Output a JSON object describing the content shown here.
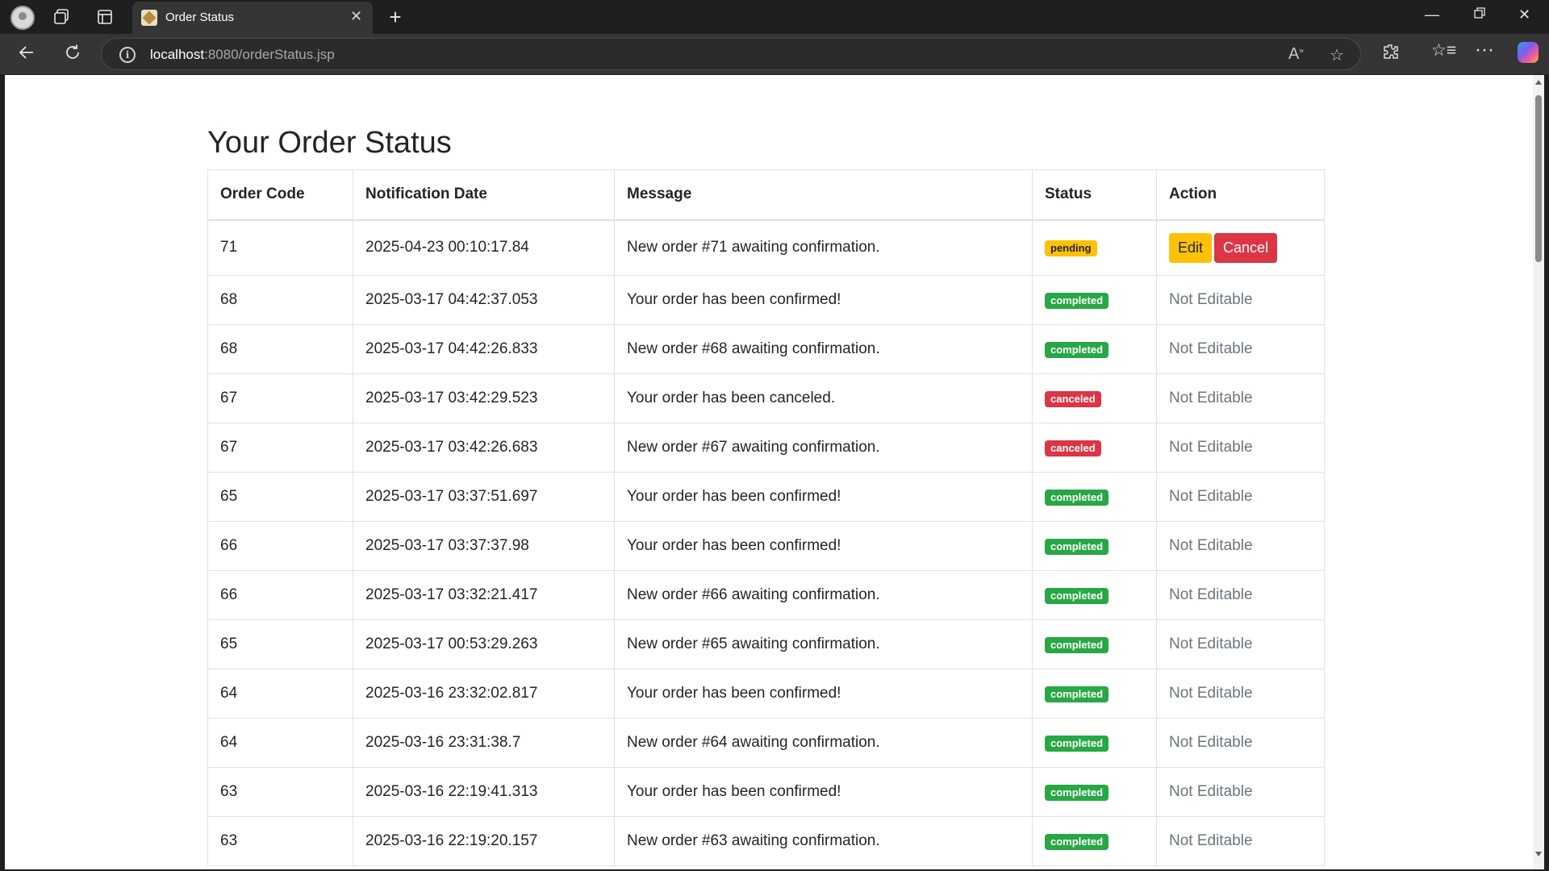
{
  "browser": {
    "tab_title": "Order Status",
    "url_host": "localhost",
    "url_path": ":8080/orderStatus.jsp"
  },
  "page": {
    "title": "Your Order Status"
  },
  "table": {
    "headers": [
      "Order Code",
      "Notification Date",
      "Message",
      "Status",
      "Action"
    ],
    "rows": [
      {
        "code": "71",
        "date": "2025-04-23 00:10:17.84",
        "message": "New order #71 awaiting confirmation.",
        "status": "pending",
        "action": "",
        "edit_label": "Edit",
        "cancel_label": "Cancel"
      },
      {
        "code": "68",
        "date": "2025-03-17 04:42:37.053",
        "message": "Your order has been confirmed!",
        "status": "completed",
        "action": "Not Editable"
      },
      {
        "code": "68",
        "date": "2025-03-17 04:42:26.833",
        "message": "New order #68 awaiting confirmation.",
        "status": "completed",
        "action": "Not Editable"
      },
      {
        "code": "67",
        "date": "2025-03-17 03:42:29.523",
        "message": "Your order has been canceled.",
        "status": "canceled",
        "action": "Not Editable"
      },
      {
        "code": "67",
        "date": "2025-03-17 03:42:26.683",
        "message": "New order #67 awaiting confirmation.",
        "status": "canceled",
        "action": "Not Editable"
      },
      {
        "code": "65",
        "date": "2025-03-17 03:37:51.697",
        "message": "Your order has been confirmed!",
        "status": "completed",
        "action": "Not Editable"
      },
      {
        "code": "66",
        "date": "2025-03-17 03:37:37.98",
        "message": "Your order has been confirmed!",
        "status": "completed",
        "action": "Not Editable"
      },
      {
        "code": "66",
        "date": "2025-03-17 03:32:21.417",
        "message": "New order #66 awaiting confirmation.",
        "status": "completed",
        "action": "Not Editable"
      },
      {
        "code": "65",
        "date": "2025-03-17 00:53:29.263",
        "message": "New order #65 awaiting confirmation.",
        "status": "completed",
        "action": "Not Editable"
      },
      {
        "code": "64",
        "date": "2025-03-16 23:32:02.817",
        "message": "Your order has been confirmed!",
        "status": "completed",
        "action": "Not Editable"
      },
      {
        "code": "64",
        "date": "2025-03-16 23:31:38.7",
        "message": "New order #64 awaiting confirmation.",
        "status": "completed",
        "action": "Not Editable"
      },
      {
        "code": "63",
        "date": "2025-03-16 22:19:41.313",
        "message": "Your order has been confirmed!",
        "status": "completed",
        "action": "Not Editable"
      },
      {
        "code": "63",
        "date": "2025-03-16 22:19:20.157",
        "message": "New order #63 awaiting confirmation.",
        "status": "completed",
        "action": "Not Editable"
      }
    ]
  },
  "colors": {
    "pending": "#ffc107",
    "completed": "#28a745",
    "canceled": "#dc3545"
  }
}
